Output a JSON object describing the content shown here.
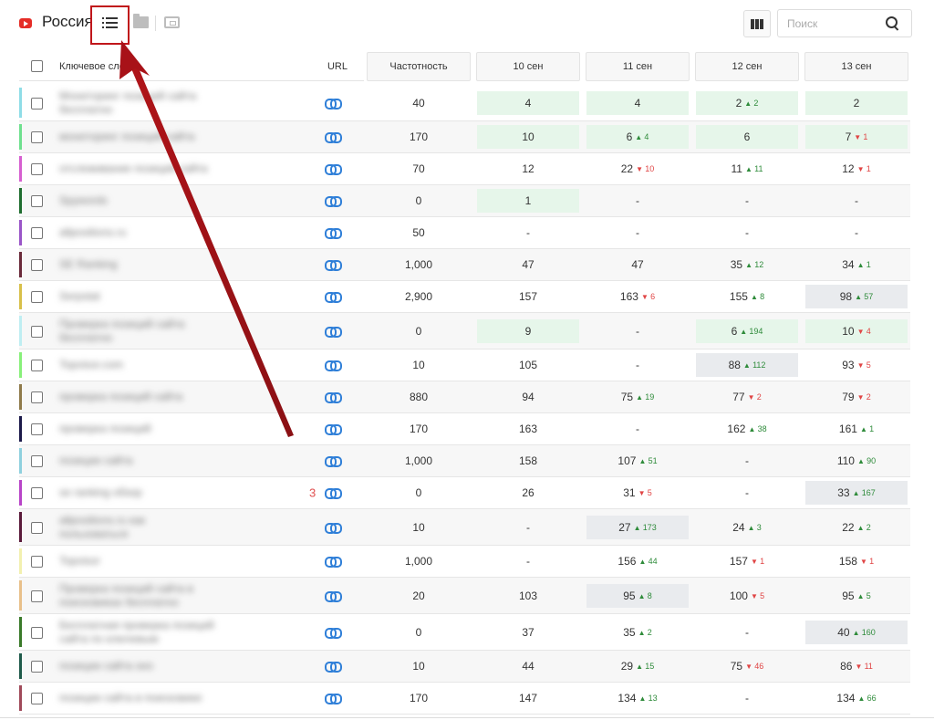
{
  "header": {
    "region": "Россия",
    "search_placeholder": "Поиск"
  },
  "table": {
    "columns": {
      "keyword": "Ключевое слово",
      "url": "URL",
      "frequency": "Частотность",
      "dates": [
        "10 сен",
        "11 сен",
        "12 сен",
        "13 сен"
      ]
    },
    "rows": [
      {
        "color": "#8fdde7",
        "kw": [
          "Мониторинг позиций сайта",
          "бесплатно"
        ],
        "url_count": "",
        "freq": "40",
        "pos": [
          {
            "v": "4",
            "bg": "green"
          },
          {
            "v": "4",
            "bg": "green"
          },
          {
            "v": "2",
            "bg": "green",
            "d": "2",
            "dir": "up"
          },
          {
            "v": "2",
            "bg": "green"
          }
        ]
      },
      {
        "color": "#6fe08f",
        "kw": [
          "мониторинг позиций сайта"
        ],
        "url_count": "",
        "freq": "170",
        "pos": [
          {
            "v": "10",
            "bg": "green"
          },
          {
            "v": "6",
            "bg": "green",
            "d": "4",
            "dir": "up"
          },
          {
            "v": "6",
            "bg": "green"
          },
          {
            "v": "7",
            "bg": "green",
            "d": "1",
            "dir": "down"
          }
        ]
      },
      {
        "color": "#d65fd0",
        "kw": [
          "отслеживание позиций сайта"
        ],
        "url_count": "",
        "freq": "70",
        "pos": [
          {
            "v": "12"
          },
          {
            "v": "22",
            "d": "10",
            "dir": "down"
          },
          {
            "v": "11",
            "d": "11",
            "dir": "up"
          },
          {
            "v": "12",
            "d": "1",
            "dir": "down"
          }
        ]
      },
      {
        "color": "#1f6d2f",
        "kw": [
          "Spywords"
        ],
        "url_count": "",
        "freq": "0",
        "pos": [
          {
            "v": "1",
            "bg": "green"
          },
          {
            "v": "-"
          },
          {
            "v": "-"
          },
          {
            "v": "-"
          }
        ]
      },
      {
        "color": "#9a55c8",
        "kw": [
          "allpositions.ru"
        ],
        "url_count": "",
        "freq": "50",
        "pos": [
          {
            "v": "-"
          },
          {
            "v": "-"
          },
          {
            "v": "-"
          },
          {
            "v": "-"
          }
        ]
      },
      {
        "color": "#6a2a3a",
        "kw": [
          "SE Ranking"
        ],
        "url_count": "",
        "freq": "1,000",
        "pos": [
          {
            "v": "47"
          },
          {
            "v": "47"
          },
          {
            "v": "35",
            "d": "12",
            "dir": "up"
          },
          {
            "v": "34",
            "d": "1",
            "dir": "up"
          }
        ]
      },
      {
        "color": "#d8c04a",
        "kw": [
          "Serpstat"
        ],
        "url_count": "",
        "freq": "2,900",
        "pos": [
          {
            "v": "157"
          },
          {
            "v": "163",
            "d": "6",
            "dir": "down"
          },
          {
            "v": "155",
            "d": "8",
            "dir": "up"
          },
          {
            "v": "98",
            "bg": "gray",
            "d": "57",
            "dir": "up"
          }
        ]
      },
      {
        "color": "#bfeef2",
        "kw": [
          "Проверка позиций сайта",
          "бесплатно"
        ],
        "url_count": "",
        "freq": "0",
        "pos": [
          {
            "v": "9",
            "bg": "green"
          },
          {
            "v": "-"
          },
          {
            "v": "6",
            "bg": "green",
            "d": "194",
            "dir": "up"
          },
          {
            "v": "10",
            "bg": "green",
            "d": "4",
            "dir": "down"
          }
        ]
      },
      {
        "color": "#88f07a",
        "kw": [
          "Topvisor.com"
        ],
        "url_count": "",
        "freq": "10",
        "pos": [
          {
            "v": "105"
          },
          {
            "v": "-"
          },
          {
            "v": "88",
            "bg": "gray",
            "d": "112",
            "dir": "up"
          },
          {
            "v": "93",
            "d": "5",
            "dir": "down"
          }
        ]
      },
      {
        "color": "#8f7a4a",
        "kw": [
          "проверка позиций сайта"
        ],
        "url_count": "",
        "freq": "880",
        "pos": [
          {
            "v": "94"
          },
          {
            "v": "75",
            "d": "19",
            "dir": "up"
          },
          {
            "v": "77",
            "d": "2",
            "dir": "down"
          },
          {
            "v": "79",
            "d": "2",
            "dir": "down"
          }
        ]
      },
      {
        "color": "#1c1a4a",
        "kw": [
          "проверка позиций"
        ],
        "url_count": "",
        "freq": "170",
        "pos": [
          {
            "v": "163"
          },
          {
            "v": "-"
          },
          {
            "v": "162",
            "d": "38",
            "dir": "up"
          },
          {
            "v": "161",
            "d": "1",
            "dir": "up"
          }
        ]
      },
      {
        "color": "#8fd0de",
        "kw": [
          "позиции сайта"
        ],
        "url_count": "",
        "freq": "1,000",
        "pos": [
          {
            "v": "158"
          },
          {
            "v": "107",
            "d": "51",
            "dir": "up"
          },
          {
            "v": "-"
          },
          {
            "v": "110",
            "d": "90",
            "dir": "up"
          }
        ]
      },
      {
        "color": "#b844c8",
        "kw": [
          "se ranking обзор"
        ],
        "url_count": "3",
        "freq": "0",
        "pos": [
          {
            "v": "26"
          },
          {
            "v": "31",
            "d": "5",
            "dir": "down"
          },
          {
            "v": "-"
          },
          {
            "v": "33",
            "bg": "gray",
            "d": "167",
            "dir": "up"
          }
        ]
      },
      {
        "color": "#5a1a3a",
        "kw": [
          "allpositions.ru как",
          "пользоваться"
        ],
        "url_count": "",
        "freq": "10",
        "pos": [
          {
            "v": "-"
          },
          {
            "v": "27",
            "bg": "gray",
            "d": "173",
            "dir": "up"
          },
          {
            "v": "24",
            "d": "3",
            "dir": "up"
          },
          {
            "v": "22",
            "d": "2",
            "dir": "up"
          }
        ]
      },
      {
        "color": "#f2f0b0",
        "kw": [
          "Topvisor"
        ],
        "url_count": "",
        "freq": "1,000",
        "pos": [
          {
            "v": "-"
          },
          {
            "v": "156",
            "d": "44",
            "dir": "up"
          },
          {
            "v": "157",
            "d": "1",
            "dir": "down"
          },
          {
            "v": "158",
            "d": "1",
            "dir": "down"
          }
        ]
      },
      {
        "color": "#e8c08a",
        "kw": [
          "Проверка позиций сайта в",
          "поисковиках бесплатно"
        ],
        "url_count": "",
        "freq": "20",
        "pos": [
          {
            "v": "103"
          },
          {
            "v": "95",
            "bg": "gray",
            "d": "8",
            "dir": "up"
          },
          {
            "v": "100",
            "d": "5",
            "dir": "down"
          },
          {
            "v": "95",
            "d": "5",
            "dir": "up"
          }
        ]
      },
      {
        "color": "#3a7a2a",
        "kw": [
          "Бесплатная проверка позиций",
          "сайта по ключевым"
        ],
        "url_count": "",
        "freq": "0",
        "pos": [
          {
            "v": "37"
          },
          {
            "v": "35",
            "d": "2",
            "dir": "up"
          },
          {
            "v": "-"
          },
          {
            "v": "40",
            "bg": "gray",
            "d": "160",
            "dir": "up"
          }
        ]
      },
      {
        "color": "#1f5a4a",
        "kw": [
          "позиции сайта seo"
        ],
        "url_count": "",
        "freq": "10",
        "pos": [
          {
            "v": "44"
          },
          {
            "v": "29",
            "d": "15",
            "dir": "up"
          },
          {
            "v": "75",
            "d": "46",
            "dir": "down"
          },
          {
            "v": "86",
            "d": "11",
            "dir": "down"
          }
        ]
      },
      {
        "color": "#a04a5a",
        "kw": [
          "позиции сайта в поисковике"
        ],
        "url_count": "",
        "freq": "170",
        "pos": [
          {
            "v": "147"
          },
          {
            "v": "134",
            "d": "13",
            "dir": "up"
          },
          {
            "v": "-"
          },
          {
            "v": "134",
            "d": "66",
            "dir": "up"
          }
        ]
      }
    ]
  }
}
